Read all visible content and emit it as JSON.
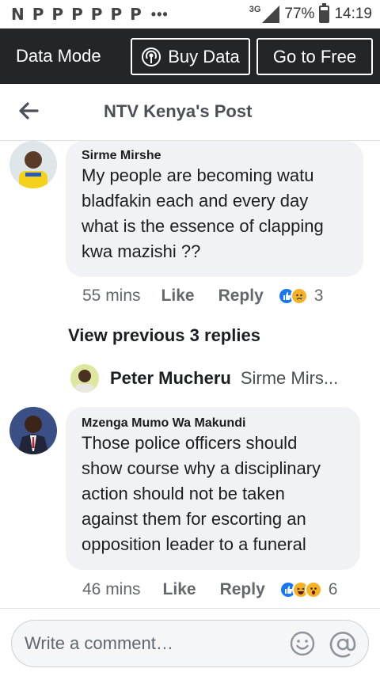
{
  "status_bar": {
    "notification_icons": [
      "N",
      "P",
      "P",
      "P",
      "P",
      "P",
      "P"
    ],
    "overflow": "•••",
    "network": "3G",
    "battery": "77%",
    "time": "14:19"
  },
  "data_bar": {
    "mode_label": "Data Mode",
    "buy_label": "Buy Data",
    "free_label": "Go to Free"
  },
  "header": {
    "title": "NTV Kenya's Post"
  },
  "comments": [
    {
      "author": "Sirme Mirshe",
      "text_lines": [
        "My people are becoming watu",
        "bladfakin each and every day",
        "what is the essence of clapping",
        "kwa mazishi ??"
      ],
      "time": "55 mins",
      "like_label": "Like",
      "reply_label": "Reply",
      "reactions": [
        "like-icon",
        "sad-icon"
      ],
      "reaction_count": "3"
    },
    {
      "author": "Mzenga Mumo Wa Makundi",
      "text_lines": [
        "Those police officers should",
        "show course why a disciplinary",
        "action should not be taken",
        "against them for escorting an",
        "opposition leader to a funeral"
      ],
      "time": "46 mins",
      "like_label": "Like",
      "reply_label": "Reply",
      "reactions": [
        "like-icon",
        "haha-icon",
        "wow-icon"
      ],
      "reaction_count": "6"
    }
  ],
  "view_previous": "View previous 3 replies",
  "reply_preview": {
    "name": "Peter Mucheru",
    "snippet": "Sirme Mirs..."
  },
  "composer": {
    "placeholder": "Write a comment…"
  },
  "colors": {
    "data_bar_bg": "#242526",
    "bubble_bg": "#f0f2f5",
    "like_blue": "#1877f2",
    "emoji_yellow": "#f7b125"
  }
}
